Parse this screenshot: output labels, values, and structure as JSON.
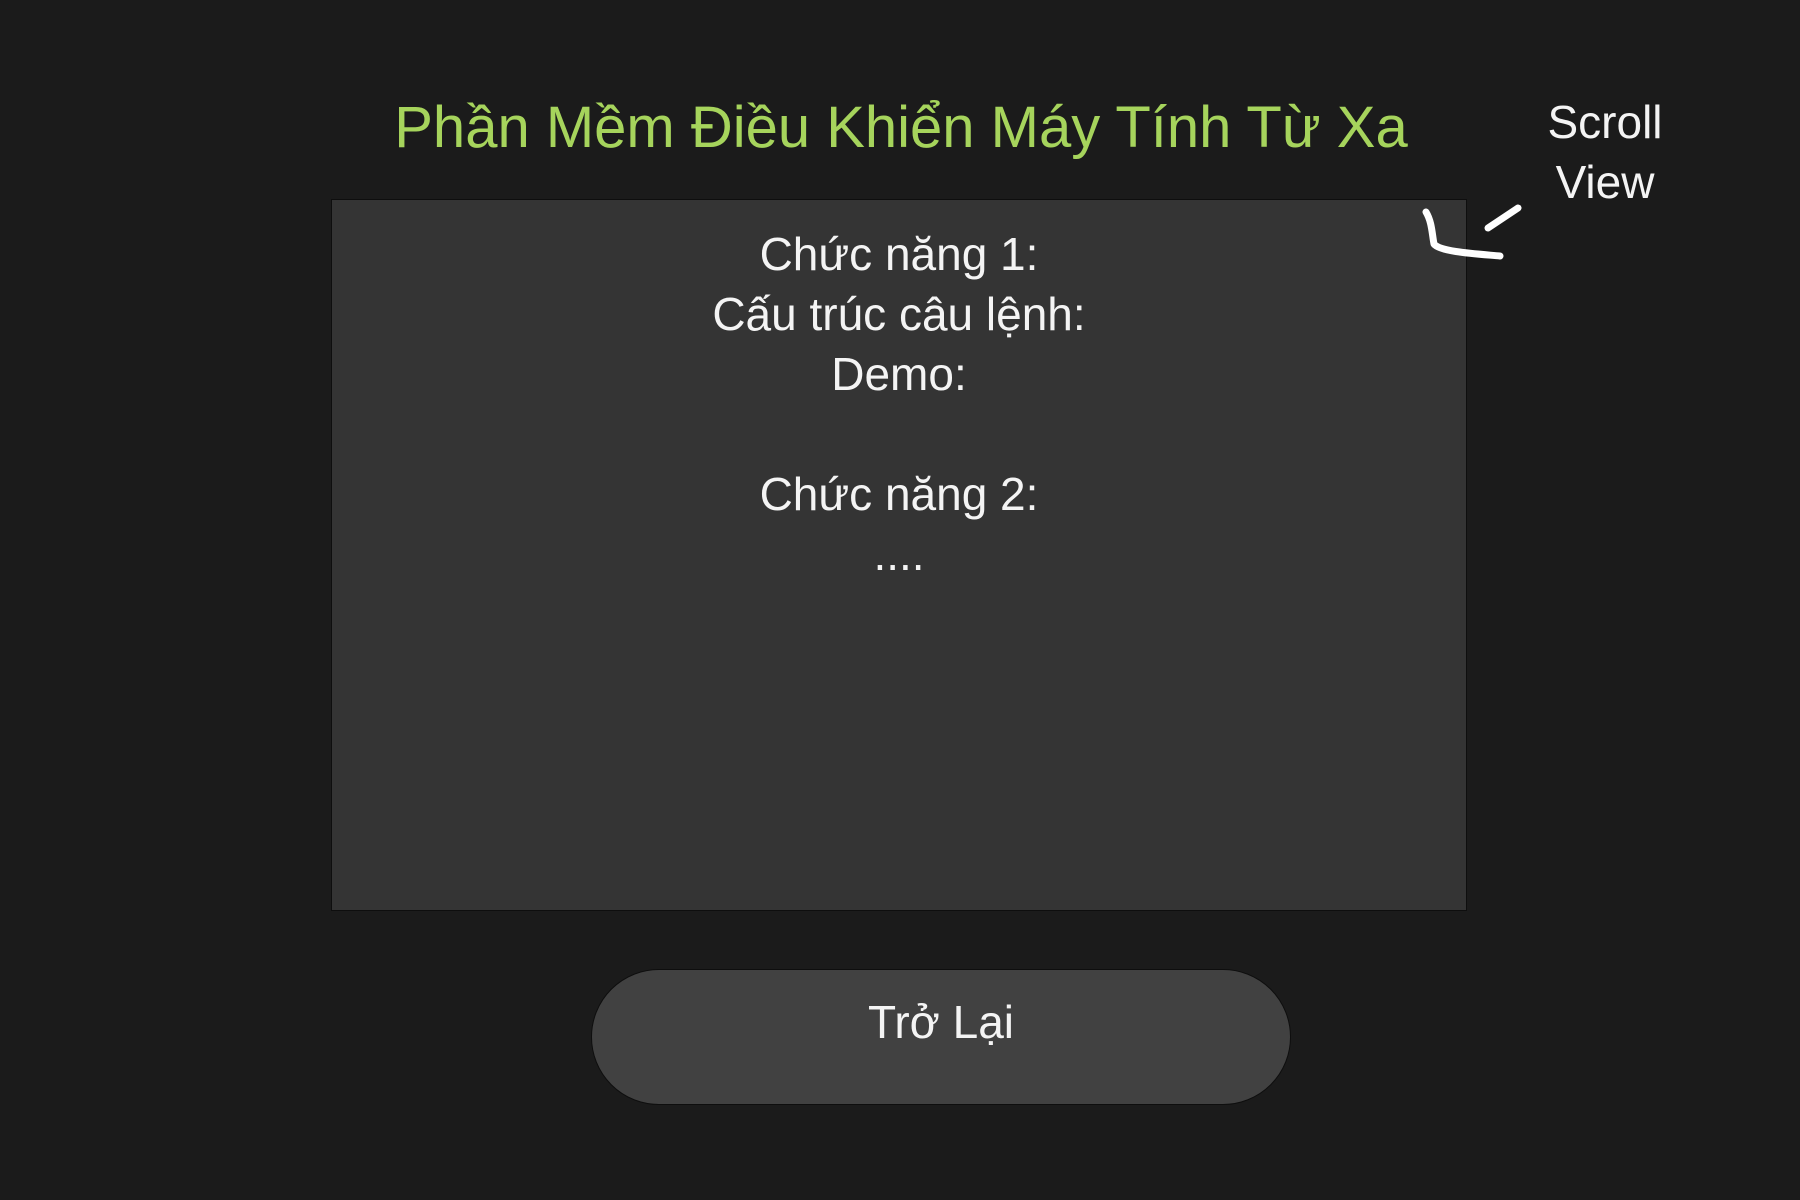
{
  "app": {
    "title": "Phần Mềm Điều Khiển Máy Tính Từ Xa"
  },
  "scroll_view": {
    "lines": [
      "Chức năng 1:",
      "Cấu trúc câu lệnh:",
      "Demo:",
      "",
      "Chức năng 2:",
      "...."
    ]
  },
  "annotation": {
    "line1": "Scroll",
    "line2": "View",
    "arrow_icon": "hand-drawn-arrow-icon"
  },
  "back_button": {
    "label": "Trở Lại"
  },
  "colors": {
    "background": "#1b1b1b",
    "title": "#a6d45c",
    "panel": "#343434",
    "button": "#414141",
    "text": "#f4f4f4"
  }
}
